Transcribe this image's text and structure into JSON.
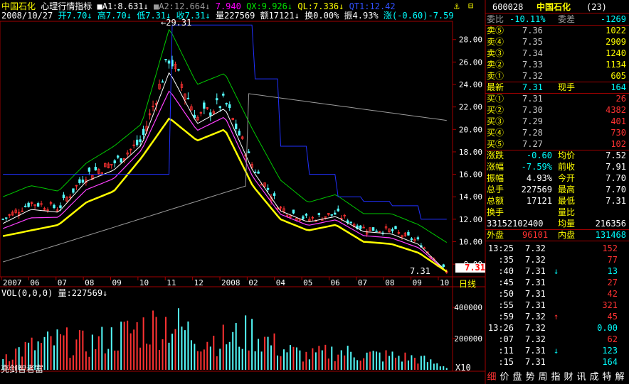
{
  "header": {
    "stock_name": "中国石化",
    "indicator_name": "心理行情指标",
    "ma1": "■A1:8.631",
    "ma1_arrow": "↓",
    "ma2": "■A2:12.664",
    "ma2_arrow": "↓",
    "ma_extra": "7.940",
    "qx": "QX:9.926",
    "qx_arrow": "↓",
    "ql": "QL:7.336",
    "ql_arrow": "↓",
    "qt": "QT1:12.42",
    "date": "2008/10/27",
    "open": "开7.70",
    "high": "高7.70",
    "low": "低7.31",
    "close": "收7.31",
    "volume": "量227569",
    "amount": "额17121",
    "turnover": "换0.00%",
    "amplitude": "振4.93%",
    "change": "涨(-0.60)-7.59"
  },
  "price_axis": [
    "28.00",
    "26.00",
    "24.00",
    "22.00",
    "20.00",
    "18.00",
    "16.00",
    "14.00",
    "12.00",
    "10.00",
    "8.00"
  ],
  "peak_label": "29.31",
  "low_label": "7.31",
  "current_price_tag": "7.31",
  "date_axis": [
    "2007",
    "06",
    "07",
    "08",
    "09",
    "10",
    "11",
    "12",
    "2008",
    "02",
    "04",
    "05",
    "06",
    "07",
    "08",
    "09",
    "10"
  ],
  "period_label": "日线",
  "vol_header": {
    "label": "VOL(0,0,0)",
    "amount": "量:227569",
    "arrow": "↓"
  },
  "vol_axis": [
    "400000",
    "200000"
  ],
  "vol_scale": "X10",
  "watermark": "亮剑智者富",
  "chart_data": {
    "type": "line",
    "title": "",
    "x": [
      "2007",
      "06",
      "07",
      "08",
      "09",
      "10",
      "11",
      "12",
      "2008",
      "02",
      "04",
      "05",
      "06",
      "07",
      "08",
      "09",
      "10"
    ],
    "ylim": [
      7.0,
      29.5
    ],
    "series": [
      {
        "name": "close",
        "values": [
          12.0,
          13.5,
          13.0,
          16.0,
          17.0,
          19.0,
          26.5,
          21.0,
          22.5,
          16.8,
          13.0,
          12.0,
          12.5,
          11.2,
          11.0,
          10.0,
          7.31
        ]
      },
      {
        "name": "QL",
        "values": [
          10.5,
          11.0,
          11.5,
          13.5,
          14.5,
          17.5,
          21.0,
          19.0,
          20.0,
          15.0,
          12.0,
          11.0,
          11.5,
          10.0,
          9.8,
          9.0,
          7.34
        ]
      },
      {
        "name": "QX",
        "values": [
          14.0,
          15.0,
          14.5,
          17.0,
          18.5,
          20.5,
          29.0,
          24.0,
          25.0,
          20.0,
          15.5,
          13.5,
          14.2,
          12.5,
          12.5,
          11.5,
          9.93
        ]
      }
    ],
    "volume": [
      120000,
      180000,
      230000,
      200000,
      260000,
      330000,
      380000,
      260000,
      240000,
      300000,
      170000,
      110000,
      150000,
      120000,
      110000,
      90000,
      22757
    ]
  },
  "quote": {
    "code": "600028",
    "name": "中国石化",
    "count": "(23)",
    "weibi_label": "委比",
    "weibi": "-10.11%",
    "weicha_label": "委差",
    "weicha": "-1269",
    "asks": [
      {
        "label": "卖⑤",
        "price": "7.36",
        "vol": "1022"
      },
      {
        "label": "卖④",
        "price": "7.35",
        "vol": "2909"
      },
      {
        "label": "卖③",
        "price": "7.34",
        "vol": "1240"
      },
      {
        "label": "卖②",
        "price": "7.33",
        "vol": "1134"
      },
      {
        "label": "卖①",
        "price": "7.32",
        "vol": "605"
      }
    ],
    "last_label": "最新",
    "last": "7.31",
    "cur_label": "现手",
    "cur": "164",
    "bids": [
      {
        "label": "买①",
        "price": "7.31",
        "vol": "26"
      },
      {
        "label": "买②",
        "price": "7.30",
        "vol": "4382"
      },
      {
        "label": "买③",
        "price": "7.29",
        "vol": "401"
      },
      {
        "label": "买④",
        "price": "7.28",
        "vol": "730"
      },
      {
        "label": "买⑤",
        "price": "7.27",
        "vol": "102"
      }
    ],
    "stats": [
      {
        "l1": "涨跌",
        "v1": "-0.60",
        "l2": "均价",
        "v2": "7.52"
      },
      {
        "l1": "涨幅",
        "v1": "-7.59%",
        "l2": "前收",
        "v2": "7.91"
      },
      {
        "l1": "振幅",
        "v1": "4.93%",
        "l2": "今开",
        "v2": "7.70"
      },
      {
        "l1": "总手",
        "v1": "227569",
        "l2": "最高",
        "v2": "7.70"
      },
      {
        "l1": "总额",
        "v1": "17121",
        "l2": "最低",
        "v2": "7.31"
      },
      {
        "l1": "换手",
        "v1": "",
        "l2": "量比",
        "v2": ""
      }
    ],
    "float_shares": "33152102400",
    "avg_vol_label": "均量",
    "avg_vol": "216356",
    "outer_label": "外盘",
    "outer": "96101",
    "inner_label": "内盘",
    "inner": "131468"
  },
  "ticks": [
    {
      "time": "13:25",
      "price": "7.32",
      "arrow": "",
      "vol": "152"
    },
    {
      "time": ":35",
      "price": "7.32",
      "arrow": "",
      "vol": "77"
    },
    {
      "time": ":40",
      "price": "7.31",
      "arrow": "↓",
      "vol": "13"
    },
    {
      "time": ":45",
      "price": "7.31",
      "arrow": "",
      "vol": "27"
    },
    {
      "time": ":50",
      "price": "7.31",
      "arrow": "",
      "vol": "42"
    },
    {
      "time": ":55",
      "price": "7.31",
      "arrow": "",
      "vol": "321"
    },
    {
      "time": ":59",
      "price": "7.32",
      "arrow": "↑",
      "vol": "45"
    },
    {
      "time": "13:26",
      "price": "7.32",
      "arrow": "",
      "vol": "0.00"
    },
    {
      "time": ":07",
      "price": "7.32",
      "arrow": "",
      "vol": "62"
    },
    {
      "time": ":11",
      "price": "7.31",
      "arrow": "↓",
      "vol": "123"
    },
    {
      "time": ":15",
      "price": "7.31",
      "arrow": "",
      "vol": "164"
    }
  ],
  "tabs": [
    "细",
    "价",
    "盘",
    "势",
    "周",
    "指",
    "财",
    "讯",
    "成",
    "特",
    "解"
  ]
}
